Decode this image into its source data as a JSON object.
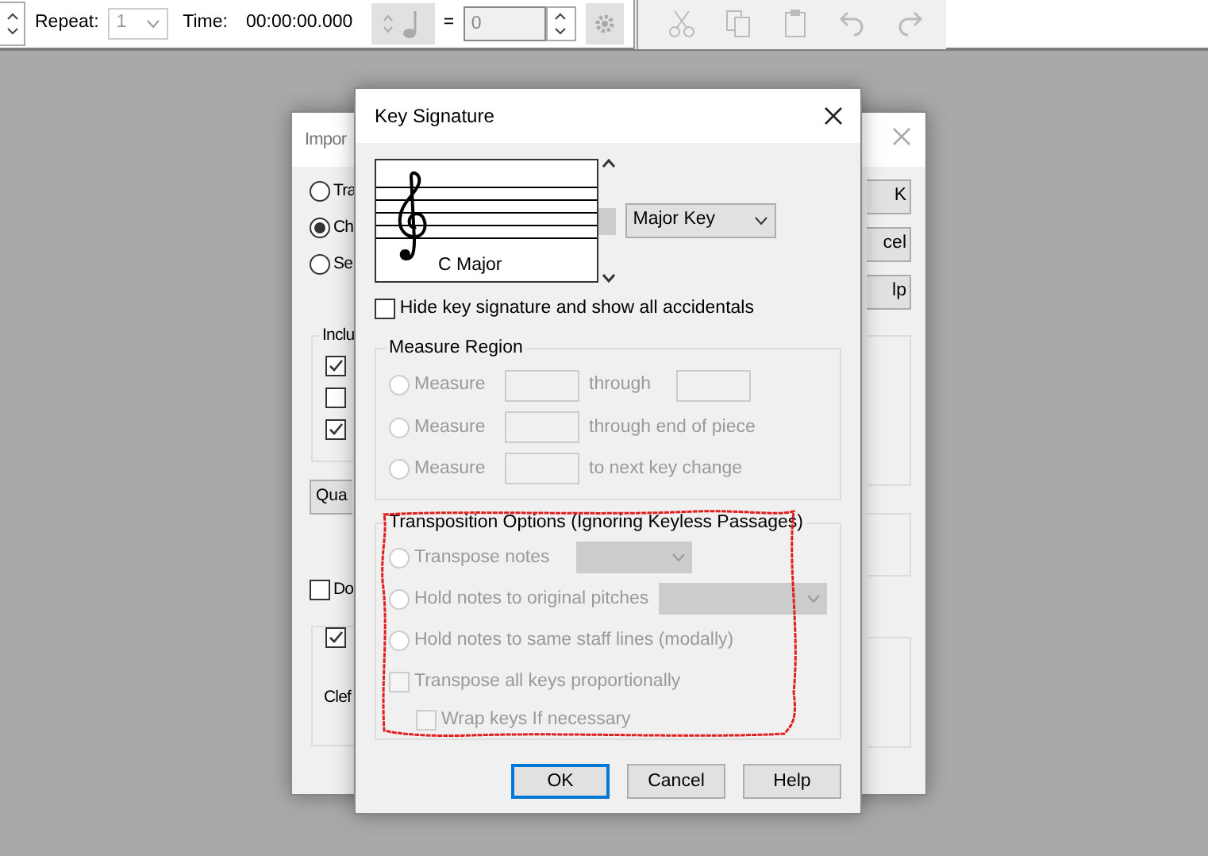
{
  "toolbar": {
    "repeat_label": "Repeat:",
    "repeat_value": "1",
    "time_label": "Time:",
    "time_value": "00:00:00.000",
    "equals": "=",
    "tempo_value": "0"
  },
  "background_dialog": {
    "title": "Impor",
    "radios": [
      {
        "label": "Tra",
        "selected": false
      },
      {
        "label": "Ch",
        "selected": true
      },
      {
        "label": "Se",
        "selected": false
      }
    ],
    "group_title": "Inclu",
    "checkboxes": [
      {
        "checked": true
      },
      {
        "checked": false
      },
      {
        "checked": true
      }
    ],
    "quantize_button": "Qua",
    "checkbox_do": {
      "label": "Do",
      "checked": false
    },
    "checkbox_lower": {
      "checked": true
    },
    "clef_label": "Clef",
    "buttons": [
      "K",
      "cel",
      "lp"
    ]
  },
  "key_signature_dialog": {
    "title": "Key Signature",
    "preview_label": "C Major",
    "key_mode": "Major Key",
    "hide_checkbox": {
      "label": "Hide key signature and show all accidentals",
      "checked": false
    },
    "measure_region": {
      "title": "Measure Region",
      "rows": [
        {
          "label": "Measure",
          "selected": false,
          "disabled": true,
          "after": "through",
          "second_field": true
        },
        {
          "label": "Measure",
          "selected": false,
          "disabled": true,
          "after": "through end of piece",
          "second_field": false
        },
        {
          "label": "Measure",
          "selected": false,
          "disabled": true,
          "after": "to next key change",
          "second_field": false
        }
      ]
    },
    "transposition": {
      "title": "Transposition Options (Ignoring Keyless Passages)",
      "options": [
        {
          "kind": "radio",
          "label": "Transpose notes",
          "selected": false,
          "disabled": true,
          "dropdown": true
        },
        {
          "kind": "radio",
          "label": "Hold notes to original pitches",
          "selected": false,
          "disabled": true,
          "dropdown": true
        },
        {
          "kind": "radio",
          "label": "Hold notes to same staff lines (modally)",
          "selected": false,
          "disabled": true,
          "dropdown": false
        },
        {
          "kind": "checkbox",
          "label": "Transpose all keys proportionally",
          "checked": false,
          "disabled": true
        },
        {
          "kind": "subcheckbox",
          "label": "Wrap keys If necessary",
          "checked": false,
          "disabled": true
        }
      ]
    },
    "buttons": [
      {
        "label": "OK",
        "default": true
      },
      {
        "label": "Cancel",
        "default": false
      },
      {
        "label": "Help",
        "default": false
      }
    ]
  }
}
